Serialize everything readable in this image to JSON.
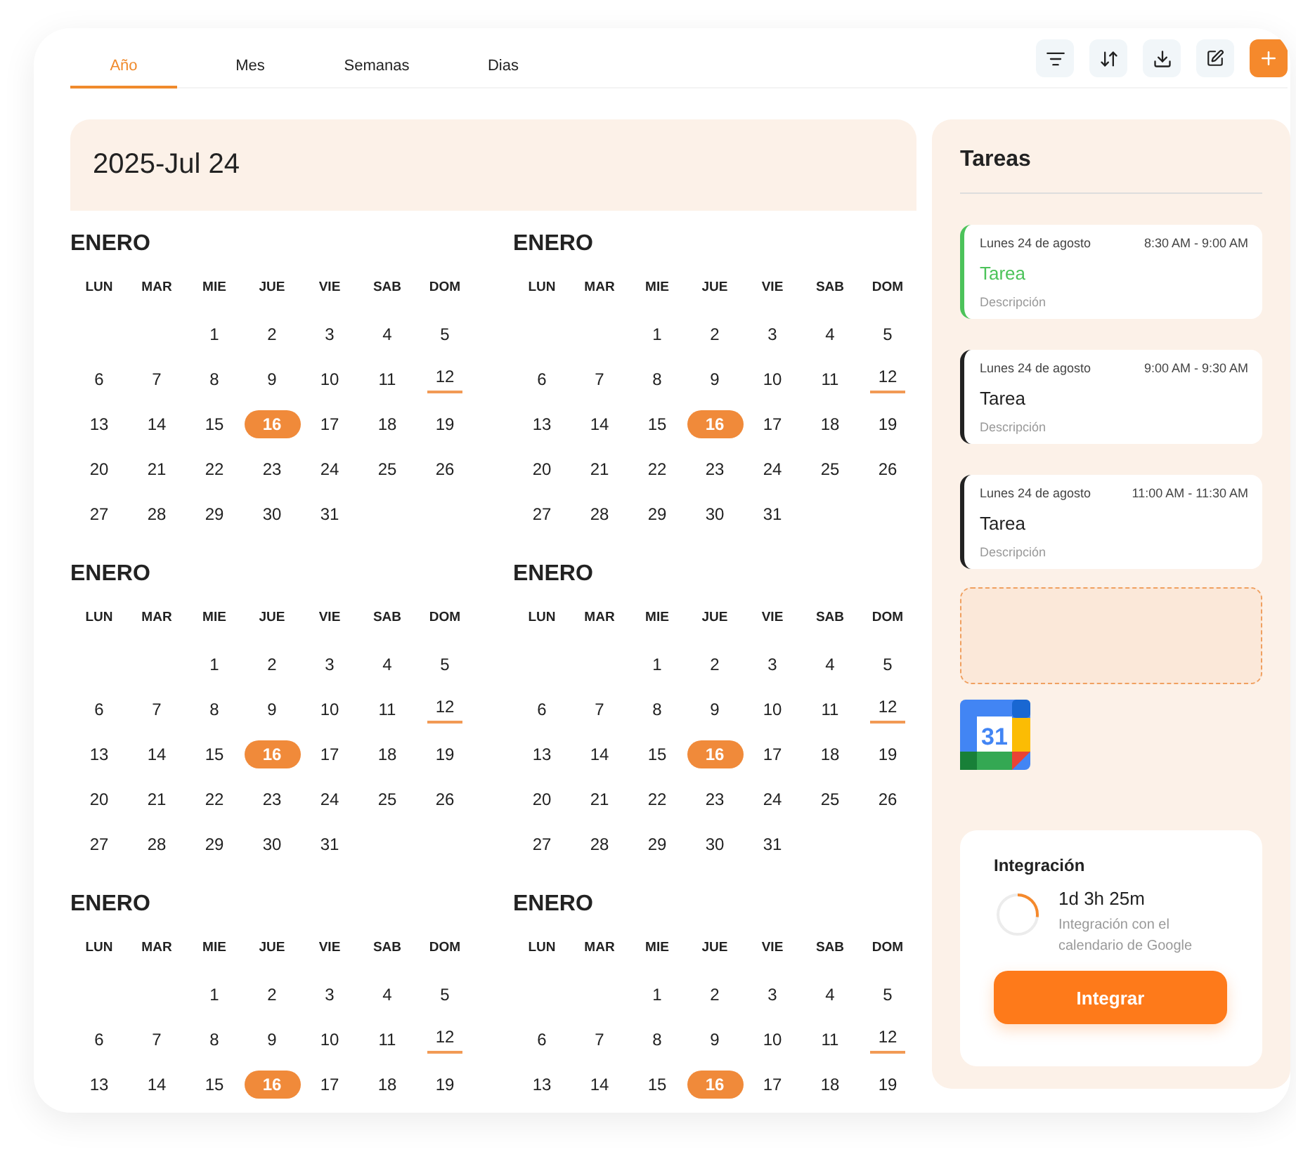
{
  "tabs": [
    {
      "label": "Año",
      "selected": true
    },
    {
      "label": "Mes",
      "selected": false
    },
    {
      "label": "Semanas",
      "selected": false
    },
    {
      "label": "Dias",
      "selected": false
    }
  ],
  "toolbar": [
    {
      "kind": "filter"
    },
    {
      "kind": "sort"
    },
    {
      "kind": "download"
    },
    {
      "kind": "edit"
    },
    {
      "kind": "add"
    }
  ],
  "date_header": "2025-Jul 24",
  "months": [
    {
      "name": "ENERO",
      "weekdays": [
        "LUN",
        "MAR",
        "MIE",
        "JUE",
        "VIE",
        "SAB",
        "DOM"
      ],
      "weeks": [
        [
          {
            "kind": "blank"
          },
          {
            "kind": "blank"
          },
          {
            "day": "1",
            "kind": "plain"
          },
          {
            "day": "2",
            "kind": "plain"
          },
          {
            "day": "3",
            "kind": "plain"
          },
          {
            "day": "4",
            "kind": "plain"
          },
          {
            "day": "5",
            "kind": "plain"
          }
        ],
        [
          {
            "day": "6",
            "kind": "plain"
          },
          {
            "day": "7",
            "kind": "plain"
          },
          {
            "day": "8",
            "kind": "plain"
          },
          {
            "day": "9",
            "kind": "plain"
          },
          {
            "day": "10",
            "kind": "plain"
          },
          {
            "day": "11",
            "kind": "plain"
          },
          {
            "day": "12",
            "kind": "underlined"
          }
        ],
        [
          {
            "day": "13",
            "kind": "plain"
          },
          {
            "day": "14",
            "kind": "plain"
          },
          {
            "day": "15",
            "kind": "plain"
          },
          {
            "day": "16",
            "kind": "highlighted"
          },
          {
            "day": "17",
            "kind": "plain"
          },
          {
            "day": "18",
            "kind": "plain"
          },
          {
            "day": "19",
            "kind": "plain"
          }
        ],
        [
          {
            "day": "20",
            "kind": "plain"
          },
          {
            "day": "21",
            "kind": "plain"
          },
          {
            "day": "22",
            "kind": "plain"
          },
          {
            "day": "23",
            "kind": "plain"
          },
          {
            "day": "24",
            "kind": "plain"
          },
          {
            "day": "25",
            "kind": "plain"
          },
          {
            "day": "26",
            "kind": "plain"
          }
        ],
        [
          {
            "day": "27",
            "kind": "plain"
          },
          {
            "day": "28",
            "kind": "plain"
          },
          {
            "day": "29",
            "kind": "plain"
          },
          {
            "day": "30",
            "kind": "plain"
          },
          {
            "day": "31",
            "kind": "plain"
          }
        ]
      ]
    },
    {
      "name": "ENERO",
      "weekdays": [
        "LUN",
        "MAR",
        "MIE",
        "JUE",
        "VIE",
        "SAB",
        "DOM"
      ],
      "weeks": [
        [
          {
            "kind": "blank"
          },
          {
            "kind": "blank"
          },
          {
            "day": "1",
            "kind": "plain"
          },
          {
            "day": "2",
            "kind": "plain"
          },
          {
            "day": "3",
            "kind": "plain"
          },
          {
            "day": "4",
            "kind": "plain"
          },
          {
            "day": "5",
            "kind": "plain"
          }
        ],
        [
          {
            "day": "6",
            "kind": "plain"
          },
          {
            "day": "7",
            "kind": "plain"
          },
          {
            "day": "8",
            "kind": "plain"
          },
          {
            "day": "9",
            "kind": "plain"
          },
          {
            "day": "10",
            "kind": "plain"
          },
          {
            "day": "11",
            "kind": "plain"
          },
          {
            "day": "12",
            "kind": "underlined"
          }
        ],
        [
          {
            "day": "13",
            "kind": "plain"
          },
          {
            "day": "14",
            "kind": "plain"
          },
          {
            "day": "15",
            "kind": "plain"
          },
          {
            "day": "16",
            "kind": "highlighted"
          },
          {
            "day": "17",
            "kind": "plain"
          },
          {
            "day": "18",
            "kind": "plain"
          },
          {
            "day": "19",
            "kind": "plain"
          }
        ],
        [
          {
            "day": "20",
            "kind": "plain"
          },
          {
            "day": "21",
            "kind": "plain"
          },
          {
            "day": "22",
            "kind": "plain"
          },
          {
            "day": "23",
            "kind": "plain"
          },
          {
            "day": "24",
            "kind": "plain"
          },
          {
            "day": "25",
            "kind": "plain"
          },
          {
            "day": "26",
            "kind": "plain"
          }
        ],
        [
          {
            "day": "27",
            "kind": "plain"
          },
          {
            "day": "28",
            "kind": "plain"
          },
          {
            "day": "29",
            "kind": "plain"
          },
          {
            "day": "30",
            "kind": "plain"
          },
          {
            "day": "31",
            "kind": "plain"
          }
        ]
      ]
    },
    {
      "name": "ENERO",
      "weekdays": [
        "LUN",
        "MAR",
        "MIE",
        "JUE",
        "VIE",
        "SAB",
        "DOM"
      ],
      "weeks": [
        [
          {
            "kind": "blank"
          },
          {
            "kind": "blank"
          },
          {
            "day": "1",
            "kind": "plain"
          },
          {
            "day": "2",
            "kind": "plain"
          },
          {
            "day": "3",
            "kind": "plain"
          },
          {
            "day": "4",
            "kind": "plain"
          },
          {
            "day": "5",
            "kind": "plain"
          }
        ],
        [
          {
            "day": "6",
            "kind": "plain"
          },
          {
            "day": "7",
            "kind": "plain"
          },
          {
            "day": "8",
            "kind": "plain"
          },
          {
            "day": "9",
            "kind": "plain"
          },
          {
            "day": "10",
            "kind": "plain"
          },
          {
            "day": "11",
            "kind": "plain"
          },
          {
            "day": "12",
            "kind": "underlined"
          }
        ],
        [
          {
            "day": "13",
            "kind": "plain"
          },
          {
            "day": "14",
            "kind": "plain"
          },
          {
            "day": "15",
            "kind": "plain"
          },
          {
            "day": "16",
            "kind": "highlighted"
          },
          {
            "day": "17",
            "kind": "plain"
          },
          {
            "day": "18",
            "kind": "plain"
          },
          {
            "day": "19",
            "kind": "plain"
          }
        ],
        [
          {
            "day": "20",
            "kind": "plain"
          },
          {
            "day": "21",
            "kind": "plain"
          },
          {
            "day": "22",
            "kind": "plain"
          },
          {
            "day": "23",
            "kind": "plain"
          },
          {
            "day": "24",
            "kind": "plain"
          },
          {
            "day": "25",
            "kind": "plain"
          },
          {
            "day": "26",
            "kind": "plain"
          }
        ],
        [
          {
            "day": "27",
            "kind": "plain"
          },
          {
            "day": "28",
            "kind": "plain"
          },
          {
            "day": "29",
            "kind": "plain"
          },
          {
            "day": "30",
            "kind": "plain"
          },
          {
            "day": "31",
            "kind": "plain"
          }
        ]
      ]
    },
    {
      "name": "ENERO",
      "weekdays": [
        "LUN",
        "MAR",
        "MIE",
        "JUE",
        "VIE",
        "SAB",
        "DOM"
      ],
      "weeks": [
        [
          {
            "kind": "blank"
          },
          {
            "kind": "blank"
          },
          {
            "day": "1",
            "kind": "plain"
          },
          {
            "day": "2",
            "kind": "plain"
          },
          {
            "day": "3",
            "kind": "plain"
          },
          {
            "day": "4",
            "kind": "plain"
          },
          {
            "day": "5",
            "kind": "plain"
          }
        ],
        [
          {
            "day": "6",
            "kind": "plain"
          },
          {
            "day": "7",
            "kind": "plain"
          },
          {
            "day": "8",
            "kind": "plain"
          },
          {
            "day": "9",
            "kind": "plain"
          },
          {
            "day": "10",
            "kind": "plain"
          },
          {
            "day": "11",
            "kind": "plain"
          },
          {
            "day": "12",
            "kind": "underlined"
          }
        ],
        [
          {
            "day": "13",
            "kind": "plain"
          },
          {
            "day": "14",
            "kind": "plain"
          },
          {
            "day": "15",
            "kind": "plain"
          },
          {
            "day": "16",
            "kind": "highlighted"
          },
          {
            "day": "17",
            "kind": "plain"
          },
          {
            "day": "18",
            "kind": "plain"
          },
          {
            "day": "19",
            "kind": "plain"
          }
        ],
        [
          {
            "day": "20",
            "kind": "plain"
          },
          {
            "day": "21",
            "kind": "plain"
          },
          {
            "day": "22",
            "kind": "plain"
          },
          {
            "day": "23",
            "kind": "plain"
          },
          {
            "day": "24",
            "kind": "plain"
          },
          {
            "day": "25",
            "kind": "plain"
          },
          {
            "day": "26",
            "kind": "plain"
          }
        ],
        [
          {
            "day": "27",
            "kind": "plain"
          },
          {
            "day": "28",
            "kind": "plain"
          },
          {
            "day": "29",
            "kind": "plain"
          },
          {
            "day": "30",
            "kind": "plain"
          },
          {
            "day": "31",
            "kind": "plain"
          }
        ]
      ]
    },
    {
      "name": "ENERO",
      "weekdays": [
        "LUN",
        "MAR",
        "MIE",
        "JUE",
        "VIE",
        "SAB",
        "DOM"
      ],
      "weeks": [
        [
          {
            "kind": "blank"
          },
          {
            "kind": "blank"
          },
          {
            "day": "1",
            "kind": "plain"
          },
          {
            "day": "2",
            "kind": "plain"
          },
          {
            "day": "3",
            "kind": "plain"
          },
          {
            "day": "4",
            "kind": "plain"
          },
          {
            "day": "5",
            "kind": "plain"
          }
        ],
        [
          {
            "day": "6",
            "kind": "plain"
          },
          {
            "day": "7",
            "kind": "plain"
          },
          {
            "day": "8",
            "kind": "plain"
          },
          {
            "day": "9",
            "kind": "plain"
          },
          {
            "day": "10",
            "kind": "plain"
          },
          {
            "day": "11",
            "kind": "plain"
          },
          {
            "day": "12",
            "kind": "underlined"
          }
        ],
        [
          {
            "day": "13",
            "kind": "plain"
          },
          {
            "day": "14",
            "kind": "plain"
          },
          {
            "day": "15",
            "kind": "plain"
          },
          {
            "day": "16",
            "kind": "highlighted"
          },
          {
            "day": "17",
            "kind": "plain"
          },
          {
            "day": "18",
            "kind": "plain"
          },
          {
            "day": "19",
            "kind": "plain"
          }
        ]
      ]
    },
    {
      "name": "ENERO",
      "weekdays": [
        "LUN",
        "MAR",
        "MIE",
        "JUE",
        "VIE",
        "SAB",
        "DOM"
      ],
      "weeks": [
        [
          {
            "kind": "blank"
          },
          {
            "kind": "blank"
          },
          {
            "day": "1",
            "kind": "plain"
          },
          {
            "day": "2",
            "kind": "plain"
          },
          {
            "day": "3",
            "kind": "plain"
          },
          {
            "day": "4",
            "kind": "plain"
          },
          {
            "day": "5",
            "kind": "plain"
          }
        ],
        [
          {
            "day": "6",
            "kind": "plain"
          },
          {
            "day": "7",
            "kind": "plain"
          },
          {
            "day": "8",
            "kind": "plain"
          },
          {
            "day": "9",
            "kind": "plain"
          },
          {
            "day": "10",
            "kind": "plain"
          },
          {
            "day": "11",
            "kind": "plain"
          },
          {
            "day": "12",
            "kind": "underlined"
          }
        ],
        [
          {
            "day": "13",
            "kind": "plain"
          },
          {
            "day": "14",
            "kind": "plain"
          },
          {
            "day": "15",
            "kind": "plain"
          },
          {
            "day": "16",
            "kind": "highlighted"
          },
          {
            "day": "17",
            "kind": "plain"
          },
          {
            "day": "18",
            "kind": "plain"
          },
          {
            "day": "19",
            "kind": "plain"
          }
        ]
      ]
    }
  ],
  "tasks_panel": {
    "title": "Tareas",
    "tasks": [
      {
        "date": "Lunes 24 de agosto",
        "time": "8:30 AM - 9:00 AM",
        "title": "Tarea",
        "description": "Descripción",
        "color": "#4cc35a"
      },
      {
        "date": "Lunes 24 de agosto",
        "time": "9:00 AM - 9:30 AM",
        "title": "Tarea",
        "description": "Descripción",
        "color": "#222222"
      },
      {
        "date": "Lunes 24 de agosto",
        "time": "11:00 AM - 11:30 AM",
        "title": "Tarea",
        "description": "Descripción",
        "color": "#222222"
      }
    ]
  },
  "calendar_app_icon": {
    "label": "31"
  },
  "integration": {
    "title": "Integración",
    "level": 0.27,
    "duration": "1d 3h 25m",
    "description": "Integración con el calendario de Google",
    "button": "Integrar"
  }
}
